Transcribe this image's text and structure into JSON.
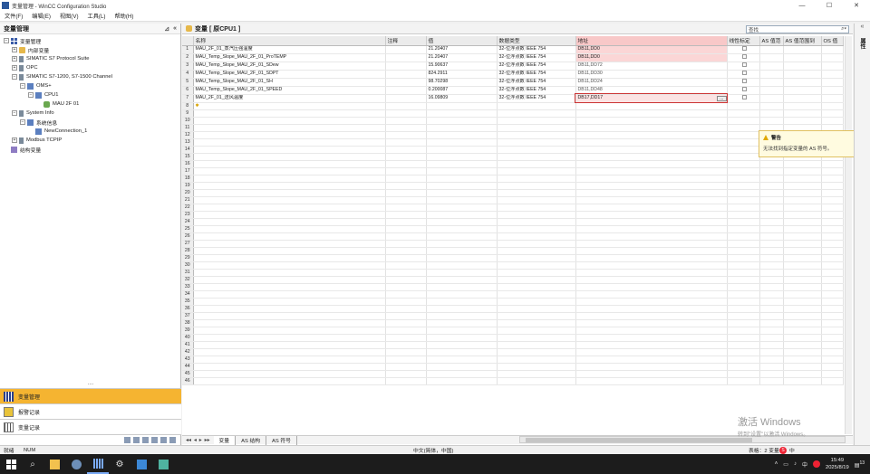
{
  "window": {
    "title": "变量管理 - WinCC Configuration Studio",
    "controls": [
      "—",
      "☐",
      "✕"
    ]
  },
  "menu": [
    "文件(F)",
    "编辑(E)",
    "视图(V)",
    "工具(L)",
    "帮助(H)"
  ],
  "left_pane": {
    "title": "变量管理",
    "tools": [
      "⊿",
      "«"
    ],
    "tree": [
      {
        "label": "变量管理",
        "level": 0,
        "expander": "−",
        "icon": "grid-icon"
      },
      {
        "label": "内部变量",
        "level": 1,
        "expander": "+",
        "icon": "folder-icon"
      },
      {
        "label": "SIMATIC S7 Protocol Suite",
        "level": 1,
        "expander": "+",
        "icon": "connector-icon"
      },
      {
        "label": "OPC",
        "level": 1,
        "expander": "+",
        "icon": "connector-icon"
      },
      {
        "label": "SIMATIC S7-1200, S7-1500 Channel",
        "level": 1,
        "expander": "−",
        "icon": "connector-icon"
      },
      {
        "label": "OMS+",
        "level": 2,
        "expander": "−",
        "icon": "plc-icon"
      },
      {
        "label": "CPU1",
        "level": 3,
        "expander": "−",
        "icon": "plc-icon"
      },
      {
        "label": "MAU 2F 01",
        "level": 4,
        "expander": "",
        "icon": "tag-group-icon"
      },
      {
        "label": "System Info",
        "level": 1,
        "expander": "−",
        "icon": "connector-icon"
      },
      {
        "label": "系统信息",
        "level": 2,
        "expander": "−",
        "icon": "plc-icon"
      },
      {
        "label": "NewConnection_1",
        "level": 3,
        "expander": "",
        "icon": "plc-icon"
      },
      {
        "label": "Modbus TCPIP",
        "level": 1,
        "expander": "+",
        "icon": "connector-icon"
      },
      {
        "label": "结构变量",
        "level": 0,
        "expander": "",
        "icon": "struct-icon"
      }
    ],
    "dots": "....",
    "nav": [
      {
        "label": "变量管理",
        "active": true,
        "icon": "tags-nav-icon"
      },
      {
        "label": "报警记录",
        "active": false,
        "icon": "alarms-nav-icon"
      },
      {
        "label": "变量记录",
        "active": false,
        "icon": "logs-nav-icon"
      }
    ]
  },
  "editor": {
    "header_title": "变量 [ 原CPU1 ]",
    "search_placeholder": "查找",
    "columns": [
      "",
      "名称",
      "注释",
      "值",
      "数据类型",
      "地址",
      "线性标定",
      "AS 值范",
      "AS 值范围到",
      "OS 值"
    ],
    "rows": [
      {
        "n": "1",
        "name": "MAU_2F_01_蒸汽压强温度",
        "value": "21.20407",
        "type": "32-位浮点数 IEEE 754",
        "addr": "DB11,DD0",
        "addr_style": "highlight"
      },
      {
        "n": "2",
        "name": "MAU_Temp_Slope_MAU_2F_01_ProTEMP",
        "value": "21.20407",
        "type": "32-位浮点数 IEEE 754",
        "addr": "DB11,DD0",
        "addr_style": "highlight"
      },
      {
        "n": "3",
        "name": "MAU_Temp_Slope_MAU_2F_01_SDew",
        "value": "15.90637",
        "type": "32-位浮点数 IEEE 754",
        "addr": "DB11,DD72",
        "addr_style": "plain"
      },
      {
        "n": "4",
        "name": "MAU_Temp_Slope_MAU_2F_01_SDPT",
        "value": "824.2911",
        "type": "32-位浮点数 IEEE 754",
        "addr": "DB11,DD30",
        "addr_style": "plain"
      },
      {
        "n": "5",
        "name": "MAU_Temp_Slope_MAU_2F_01_SH",
        "value": "98.70298",
        "type": "32-位浮点数 IEEE 754",
        "addr": "DB11,DD24",
        "addr_style": "plain"
      },
      {
        "n": "6",
        "name": "MAU_Temp_Slope_MAU_2F_01_SPEED",
        "value": "0.200087",
        "type": "32-位浮点数 IEEE 754",
        "addr": "DB11,DD48",
        "addr_style": "plain"
      },
      {
        "n": "7",
        "name": "MAU_2F_01_送风温度",
        "value": "16.09809",
        "type": "32-位浮点数 IEEE 754",
        "addr": "DB17,DD17",
        "addr_style": "error"
      }
    ],
    "empty_row_start": 8,
    "empty_row_end": 46,
    "new_row_marker": "✱",
    "edit_button": "...",
    "tooltip": {
      "title": "警告",
      "body": "无法找到指定变量的 AS 符号。"
    },
    "bottom_tabs": [
      "变量",
      "AS 结构",
      "AS 符号"
    ],
    "tab_nav": [
      "◂◂",
      "◂",
      "▸",
      "▸▸"
    ]
  },
  "right_strip": {
    "collapse": "«",
    "label": "属性"
  },
  "statusbar": {
    "ready": "就绪",
    "num": "NUM",
    "locale": "中文(简体，中国)",
    "table": "表格：2 变量"
  },
  "watermark": {
    "line1": "激活 Windows",
    "line2": "转到\"设置\"以激活 Windows。"
  },
  "taskbar": {
    "time": "15:49",
    "date": "2025/8/19",
    "ime": "中",
    "notif": "13"
  },
  "colors": {
    "nav_active": "#f5b431",
    "address_highlight": "#fbd6d6",
    "address_error_border": "#cc3333",
    "tooltip_bg": "#fffbe0"
  }
}
